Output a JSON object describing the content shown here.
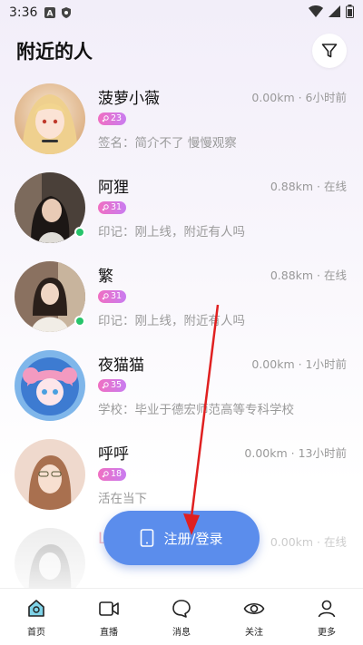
{
  "status_bar": {
    "time": "3:36"
  },
  "header": {
    "title": "附近的人"
  },
  "users": [
    {
      "name": "菠萝小薇",
      "meta": "0.00km · 6小时前",
      "badge": "23",
      "bio": "签名：简介不了 慢慢观察",
      "online": false,
      "avatar_colors": [
        "#f3dcc0",
        "#e8b88c"
      ]
    },
    {
      "name": "阿狸",
      "meta": "0.88km · 在线",
      "badge": "31",
      "bio": "印记：刚上线，附近有人吗",
      "online": true,
      "avatar_colors": [
        "#a98d7c",
        "#3b3330"
      ]
    },
    {
      "name": "繁",
      "meta": "0.88km · 在线",
      "badge": "31",
      "bio": "印记：刚上线，附近有人吗",
      "online": true,
      "avatar_colors": [
        "#c8a688",
        "#6f5646"
      ]
    },
    {
      "name": "夜猫猫",
      "meta": "0.00km · 1小时前",
      "badge": "35",
      "bio": "学校：毕业于德宏师范高等专科学校",
      "online": false,
      "avatar_colors": [
        "#f5a9c6",
        "#6aa3e0"
      ]
    },
    {
      "name": "呼呼",
      "meta": "0.00km · 13小时前",
      "badge": "18",
      "bio": "活在当下",
      "online": false,
      "avatar_colors": [
        "#f1d3c4",
        "#b98b72"
      ]
    },
    {
      "name": "L",
      "meta": "0.00km · 在线",
      "badge": "",
      "bio": "",
      "online": false,
      "avatar_colors": [
        "#dddddd",
        "#aaaaaa"
      ]
    }
  ],
  "register_button": {
    "label": "注册/登录"
  },
  "tabs": [
    {
      "label": "首页",
      "icon": "home-icon"
    },
    {
      "label": "直播",
      "icon": "video-icon"
    },
    {
      "label": "消息",
      "icon": "message-icon"
    },
    {
      "label": "关注",
      "icon": "eye-icon"
    },
    {
      "label": "更多",
      "icon": "user-icon"
    }
  ],
  "colors": {
    "accent": "#5b8dec",
    "online": "#27c46b",
    "badge": "#e974c9",
    "arrow": "#e02020"
  }
}
